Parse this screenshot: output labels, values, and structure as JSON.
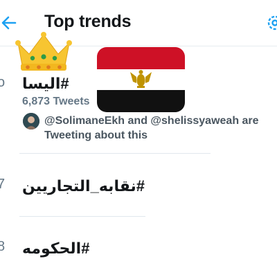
{
  "header": {
    "title": "Top trends",
    "back_icon": "back-arrow-icon",
    "settings_icon": "gear-icon",
    "accent_color": "#1da1f2"
  },
  "decorations": {
    "crown": "crown-emoji",
    "flag": "egypt-flag-emoji"
  },
  "trends": [
    {
      "name": "#اليسا",
      "tweet_count": "6,873 Tweets",
      "context": "@SolimaneEkh and @shelissyaweah are Tweeting about this"
    },
    {
      "name": "#نقابه_التجاريين"
    },
    {
      "name": "#الحكومه"
    }
  ]
}
